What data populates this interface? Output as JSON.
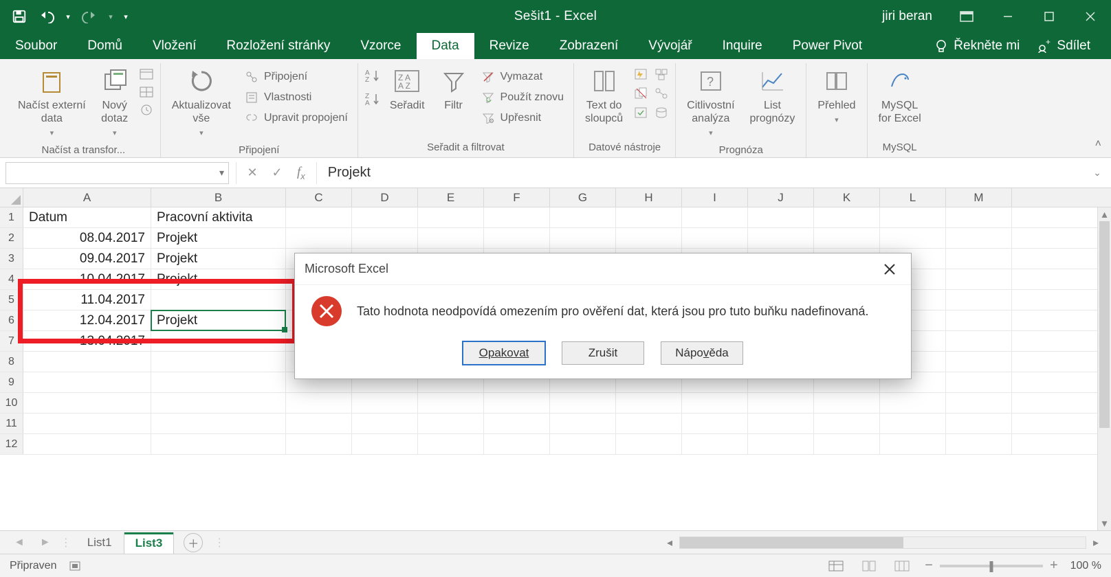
{
  "title": "Sešit1  -  Excel",
  "user": "jiri beran",
  "tabs": {
    "file": "Soubor",
    "home": "Domů",
    "insert": "Vložení",
    "page_layout": "Rozložení stránky",
    "formulas": "Vzorce",
    "data": "Data",
    "review": "Revize",
    "view": "Zobrazení",
    "developer": "Vývojář",
    "inquire": "Inquire",
    "power_pivot": "Power Pivot",
    "active": "data"
  },
  "tell_me": "Řekněte mi",
  "share": "Sdílet",
  "ribbon": {
    "groups": {
      "get_transform": {
        "label": "Načíst a transfor...",
        "get_external": "Načíst externí\ndata",
        "new_query": "Nový\ndotaz"
      },
      "connections": {
        "label": "Připojení",
        "refresh_all": "Aktualizovat\nvše",
        "connections": "Připojení",
        "properties": "Vlastnosti",
        "edit_links": "Upravit propojení"
      },
      "sort_filter": {
        "label": "Seřadit a filtrovat",
        "sort": "Seřadit",
        "filter": "Filtr",
        "clear": "Vymazat",
        "reapply": "Použít znovu",
        "advanced": "Upřesnit"
      },
      "data_tools": {
        "label": "Datové nástroje",
        "text_to_columns": "Text do\nsloupců"
      },
      "forecast": {
        "label": "Prognóza",
        "whatif": "Citlivostní\nanalýza",
        "forecast_sheet": "List\nprognózy"
      },
      "outline": {
        "label": "",
        "outline": "Přehled"
      },
      "mysql": {
        "label": "MySQL",
        "mysql_excel": "MySQL\nfor Excel"
      }
    }
  },
  "namebox": "",
  "formula": "Projekt",
  "columns": [
    "A",
    "B",
    "C",
    "D",
    "E",
    "F",
    "G",
    "H",
    "I",
    "J",
    "K",
    "L",
    "M"
  ],
  "row_headers": [
    "1",
    "2",
    "3",
    "4",
    "5",
    "6",
    "7",
    "8",
    "9",
    "10",
    "11",
    "12"
  ],
  "data_rows": [
    {
      "a": "Datum",
      "b": "Pracovní aktivita",
      "header": true
    },
    {
      "a": "08.04.2017",
      "b": "Projekt"
    },
    {
      "a": "09.04.2017",
      "b": "Projekt"
    },
    {
      "a": "10.04.2017",
      "b": "Projekt"
    },
    {
      "a": "11.04.2017",
      "b": ""
    },
    {
      "a": "12.04.2017",
      "b": "Projekt"
    },
    {
      "a": "13.04.2017",
      "b": ""
    },
    {
      "a": "",
      "b": ""
    },
    {
      "a": "",
      "b": ""
    },
    {
      "a": "",
      "b": ""
    },
    {
      "a": "",
      "b": ""
    },
    {
      "a": "",
      "b": ""
    }
  ],
  "sheets": {
    "list": [
      "List1",
      "List3"
    ],
    "active": "List3"
  },
  "status": {
    "ready": "Připraven",
    "zoom": "100 %"
  },
  "dialog": {
    "title": "Microsoft Excel",
    "message": "Tato hodnota neodpovídá omezením pro ověření dat, která jsou pro tuto buňku nadefinovaná.",
    "buttons": {
      "retry": "Opakovat",
      "cancel": "Zrušit",
      "help": "Nápověda"
    }
  }
}
